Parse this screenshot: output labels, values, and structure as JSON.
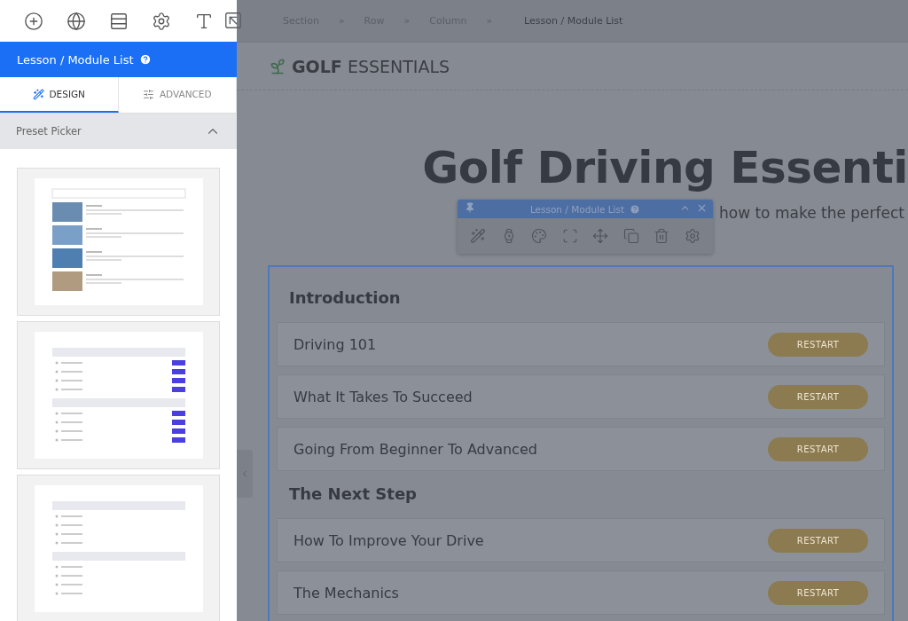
{
  "panel": {
    "title": "Lesson / Module List",
    "tabs": [
      {
        "label": "DESIGN",
        "selected": true
      },
      {
        "label": "ADVANCED",
        "selected": false
      }
    ],
    "section": {
      "title": "Preset Picker",
      "expanded": true
    },
    "presets": [
      {
        "kind": "images"
      },
      {
        "kind": "buttons"
      },
      {
        "kind": "bullets"
      }
    ]
  },
  "breadcrumbs": [
    "Section",
    "Row",
    "Column"
  ],
  "breadcrumb_separator": "»",
  "breadcrumb_current": "Lesson / Module List",
  "logo": {
    "bold": "GOLF",
    "light": "ESSENTIALS"
  },
  "hero": {
    "title": "Golf Driving Essenti",
    "subtitle": "how to make the perfect"
  },
  "module_toolbar": {
    "title": "Lesson / Module List"
  },
  "course": [
    {
      "title": "Introduction",
      "lessons": [
        {
          "title": "Driving 101",
          "button": "RESTART"
        },
        {
          "title": "What It Takes To Succeed",
          "button": "RESTART"
        },
        {
          "title": "Going From Beginner To Advanced",
          "button": "RESTART"
        }
      ]
    },
    {
      "title": "The Next Step",
      "lessons": [
        {
          "title": "How To Improve Your Drive",
          "button": "RESTART"
        },
        {
          "title": "The Mechanics",
          "button": "RESTART"
        }
      ]
    }
  ]
}
